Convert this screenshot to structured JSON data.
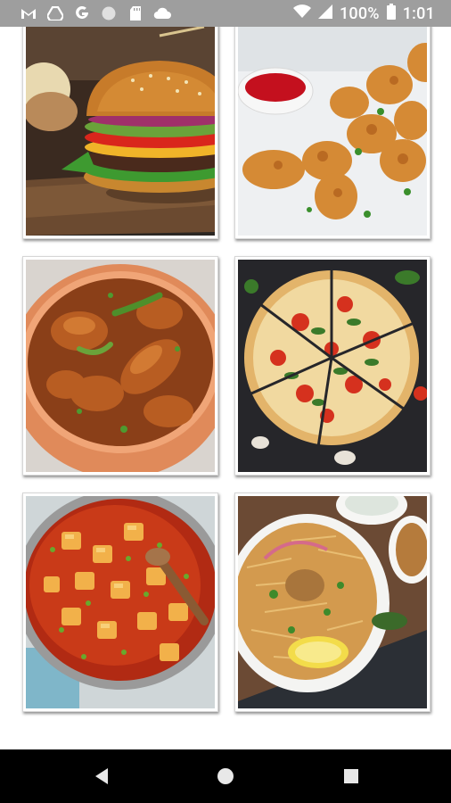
{
  "status_bar": {
    "notification_icons": [
      "gmail-icon",
      "drive-icon",
      "google-icon",
      "circle-icon",
      "sd-card-icon",
      "cloud-icon"
    ],
    "battery": "100%",
    "time": "1:01"
  },
  "grid": {
    "tiles": [
      {
        "dish": "burger"
      },
      {
        "dish": "fried-chicken"
      },
      {
        "dish": "chicken-curry"
      },
      {
        "dish": "pizza"
      },
      {
        "dish": "paneer-masala"
      },
      {
        "dish": "biryani"
      }
    ]
  },
  "nav_bar": {
    "buttons": [
      "back",
      "home",
      "recents"
    ]
  },
  "colors": {
    "status_bar_bg": "#9e9e9e",
    "nav_bar_bg": "#000000",
    "background": "#ffffff"
  }
}
